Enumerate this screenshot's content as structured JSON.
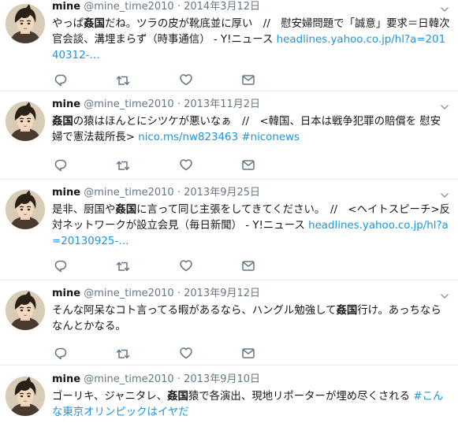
{
  "tweets": [
    {
      "name": "mine",
      "handle": "@mine_time2010",
      "dot": "·",
      "date": "2014年3月12日",
      "segments": [
        {
          "t": "やっぱ",
          "s": "n"
        },
        {
          "t": "姦国",
          "s": "b"
        },
        {
          "t": "だね。ツラの皮が靴底並に厚い　//　慰安婦問題で「誠意」要求＝日韓次官会談、溝埋まらず（時事通信） - Y!ニュース ",
          "s": "n"
        },
        {
          "t": "headlines.yahoo.co.jp/hl?a=20140312-…",
          "s": "l"
        }
      ]
    },
    {
      "name": "mine",
      "handle": "@mine_time2010",
      "dot": "·",
      "date": "2013年11月2日",
      "segments": [
        {
          "t": "姦国",
          "s": "b"
        },
        {
          "t": "の猿はほんとにシツケが悪いなぁ　//　<韓国、日本は戦争犯罪の賠償を 慰安婦で憲法裁所長> ",
          "s": "n"
        },
        {
          "t": "nico.ms/nw823463",
          "s": "l"
        },
        {
          "t": " ",
          "s": "n"
        },
        {
          "t": "#niconews",
          "s": "l"
        }
      ]
    },
    {
      "name": "mine",
      "handle": "@mine_time2010",
      "dot": "·",
      "date": "2013年9月25日",
      "segments": [
        {
          "t": "是非、厨国や",
          "s": "n"
        },
        {
          "t": "姦国",
          "s": "b"
        },
        {
          "t": "に言って同じ主張をしてきてください。　//　<ヘイトスピーチ>反対ネットワークが設立会見（毎日新聞） - Y!ニュース ",
          "s": "n"
        },
        {
          "t": "headlines.yahoo.co.jp/hl?a=20130925-…",
          "s": "l"
        }
      ]
    },
    {
      "name": "mine",
      "handle": "@mine_time2010",
      "dot": "·",
      "date": "2013年9月12日",
      "segments": [
        {
          "t": "そんな阿呆なコト言ってる暇があるなら、ハングル勉強して",
          "s": "n"
        },
        {
          "t": "姦国",
          "s": "b"
        },
        {
          "t": "行け。あっちならなんとかなる。",
          "s": "n"
        }
      ]
    },
    {
      "name": "mine",
      "handle": "@mine_time2010",
      "dot": "·",
      "date": "2013年9月10日",
      "segments": [
        {
          "t": "ゴーリキ、ジャニタレ、",
          "s": "n"
        },
        {
          "t": "姦国",
          "s": "b"
        },
        {
          "t": "猿で各演出、現地リポーターが埋め尽くされる ",
          "s": "n"
        },
        {
          "t": "#こんな東京オリンピックはイヤだ",
          "s": "l"
        }
      ]
    }
  ],
  "icons": [
    "reply-icon",
    "retweet-icon",
    "like-icon",
    "message-icon",
    "chevron-down-icon"
  ],
  "colors": {
    "link": "#1b95e0",
    "muted": "#657786",
    "text": "#14171a",
    "divider": "#e6ecf0"
  }
}
